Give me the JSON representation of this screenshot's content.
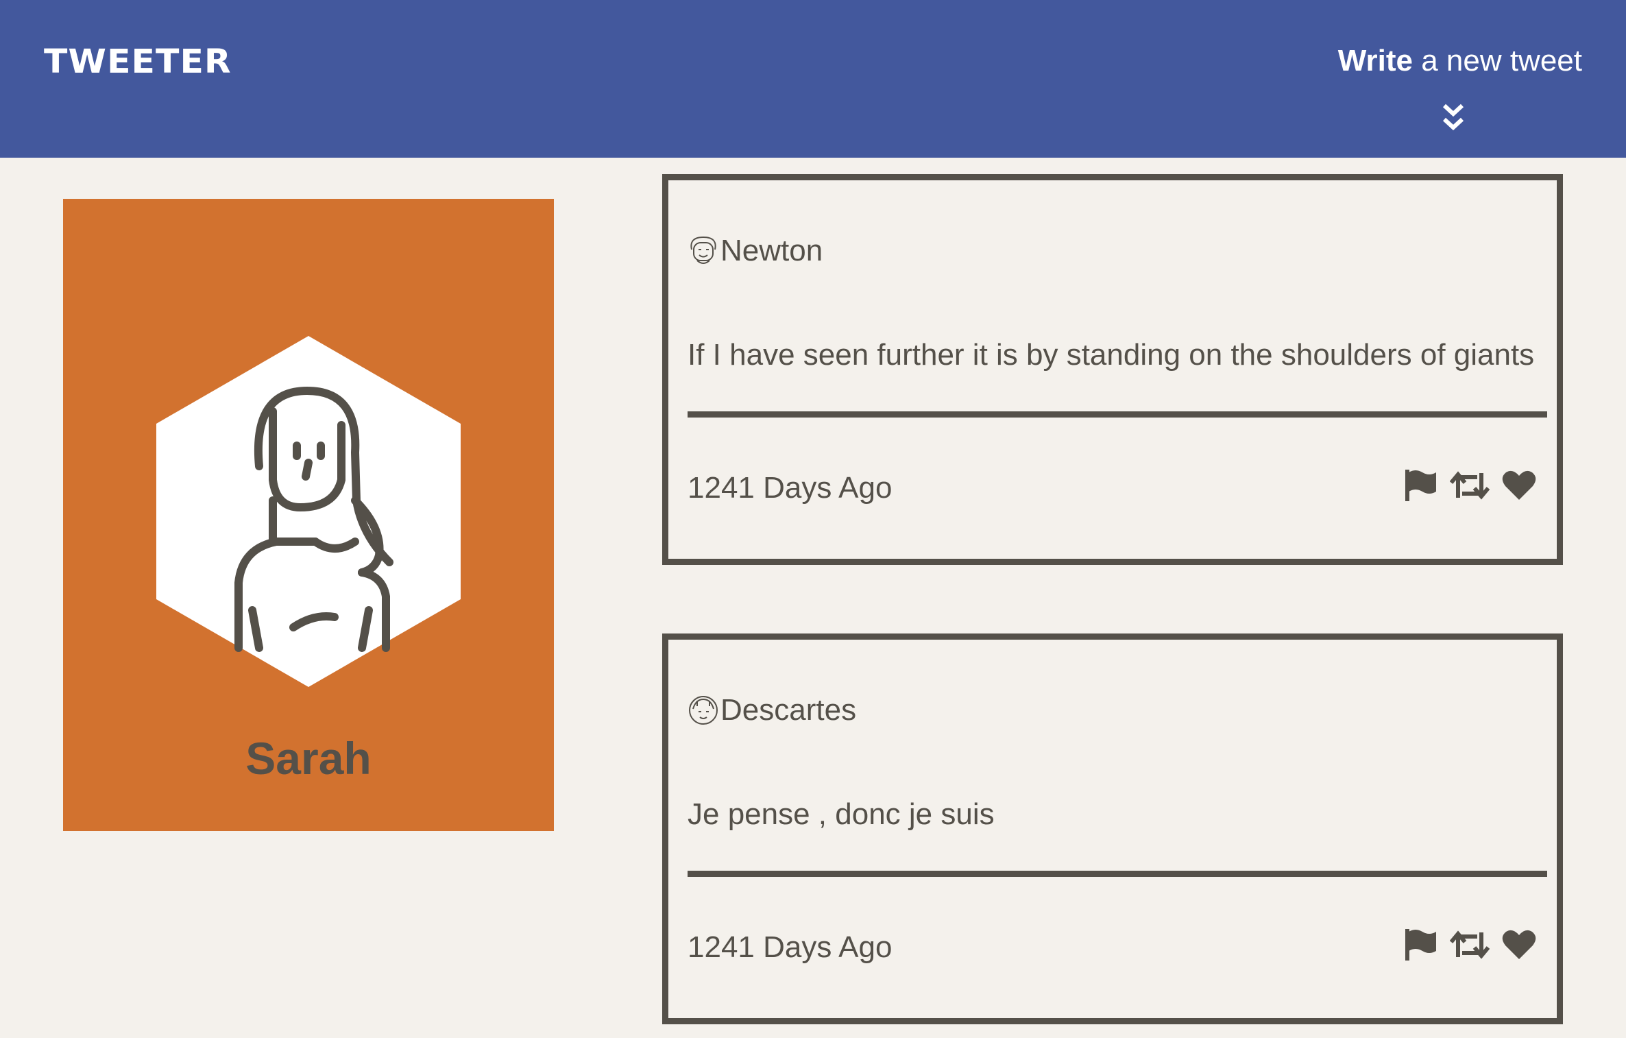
{
  "header": {
    "logo": "TWEETER",
    "compose_bold": "Write",
    "compose_rest": " a new tweet",
    "compose_icon": "double-chevron-down-icon"
  },
  "profile": {
    "name": "Sarah",
    "avatar_icon": "woman-avatar-icon",
    "card_color": "#D2722F"
  },
  "tweets": [
    {
      "user": "Newton",
      "avatar_icon": "man-avatar-icon",
      "text": "If I have seen further it is by standing on the shoulders of giants",
      "time": "1241 Days Ago",
      "actions": [
        "flag-icon",
        "retweet-icon",
        "heart-icon"
      ]
    },
    {
      "user": "Descartes",
      "avatar_icon": "face-avatar-icon",
      "text": "Je pense , donc je suis",
      "time": "1241 Days Ago",
      "actions": [
        "flag-icon",
        "retweet-icon",
        "heart-icon"
      ]
    }
  ],
  "colors": {
    "header": "#43589D",
    "background": "#F4F1EC",
    "text": "#545049"
  }
}
